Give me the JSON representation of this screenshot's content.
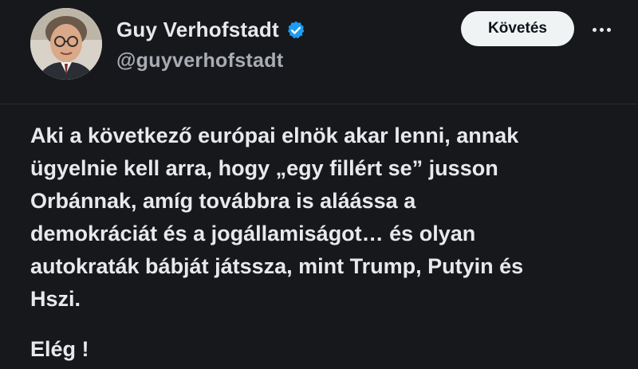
{
  "author": {
    "display_name": "Guy Verhofstadt",
    "handle": "@guyverhofstadt",
    "verified_icon": "verified-badge-icon"
  },
  "actions": {
    "follow_label": "Követés",
    "more_icon": "more-options-icon"
  },
  "tweet": {
    "lines": [
      "Aki a következő európai elnök akar lenni, annak",
      "ügyelnie kell arra, hogy „egy fillért se” jusson",
      "Orbánnak, amíg továbbra is aláássa a",
      "demokráciát és a jogállamiságot… és olyan",
      "autokraták bábját játssza, mint Trump, Putyin és",
      "Hszi."
    ],
    "closing": "Elég !"
  },
  "colors": {
    "background": "#16181c",
    "text": "#e7e9ea",
    "secondary_text": "#a9adb3",
    "verified": "#1d9bf0",
    "button_bg": "#eff3f4"
  }
}
